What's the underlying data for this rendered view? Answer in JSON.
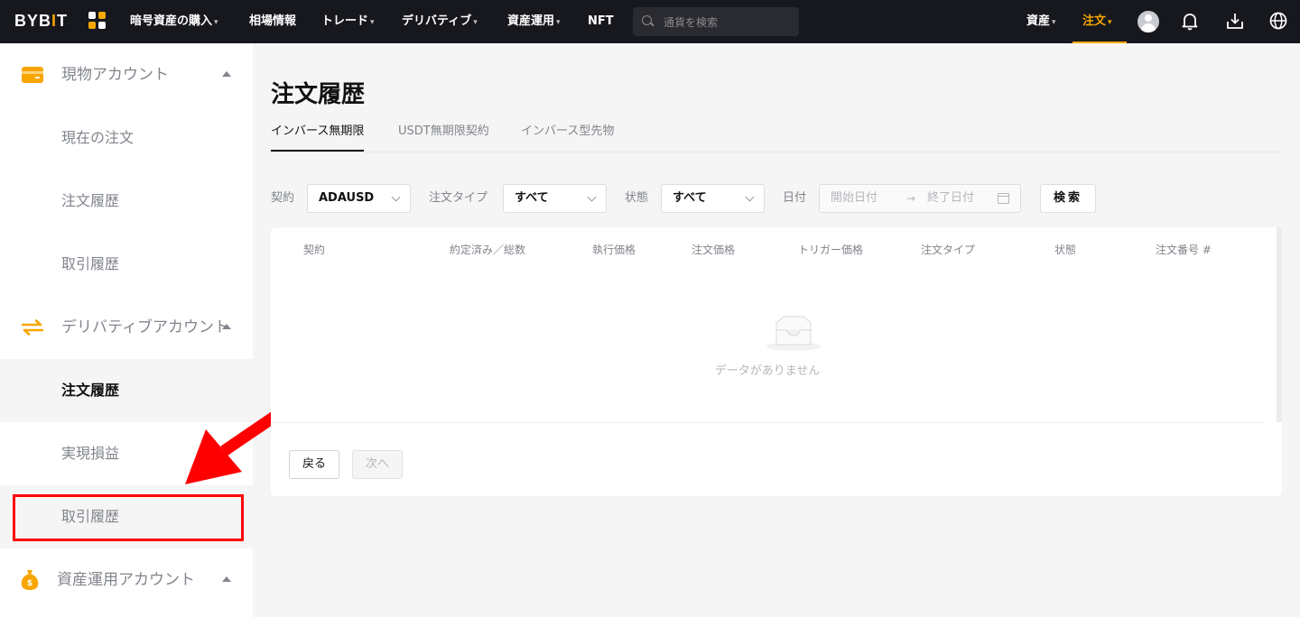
{
  "topbar": {
    "logo": {
      "left": "BYB",
      "bar": "I",
      "right": "T"
    },
    "nav": [
      {
        "label": "暗号資産の購入",
        "caret": true
      },
      {
        "label": "相場情報",
        "caret": false
      },
      {
        "label": "トレード",
        "caret": true
      },
      {
        "label": "デリバティブ",
        "caret": true
      },
      {
        "label": "資産運用",
        "caret": true
      },
      {
        "label": "NFT",
        "caret": false
      }
    ],
    "search_placeholder": "通貨を検索",
    "assets_label": "資産",
    "orders_label": "注文",
    "caret_glyph": "▾"
  },
  "sidebar": {
    "spot_account": "現物アカウント",
    "spot_items": [
      "現在の注文",
      "注文履歴",
      "取引履歴"
    ],
    "derivatives_account": "デリバティブアカウント",
    "derivatives_items": [
      "注文履歴",
      "実現損益",
      "取引履歴"
    ],
    "earn_account": "資産運用アカウント"
  },
  "main": {
    "title": "注文履歴",
    "tabs": [
      "インバース無期限",
      "USDT無期限契約",
      "インバース型先物"
    ],
    "filters": {
      "contract_label": "契約",
      "contract_value": "ADAUSD",
      "order_type_label": "注文タイプ",
      "order_type_value": "すべて",
      "status_label": "状態",
      "status_value": "すべて",
      "date_label": "日付",
      "start_placeholder": "開始日付",
      "end_placeholder": "終了日付",
      "range_arrow": "→",
      "search_button": "検索"
    },
    "table": {
      "columns": [
        "契約",
        "約定済み／総数",
        "執行価格",
        "注文価格",
        "トリガー価格",
        "注文タイプ",
        "状態",
        "注文番号 #"
      ],
      "empty_text": "データがありません"
    },
    "pagination": {
      "prev": "戻る",
      "next": "次へ"
    }
  },
  "colors": {
    "accent": "#f7a600",
    "highlight": "#ff0000",
    "topbar_bg": "#17181e"
  }
}
